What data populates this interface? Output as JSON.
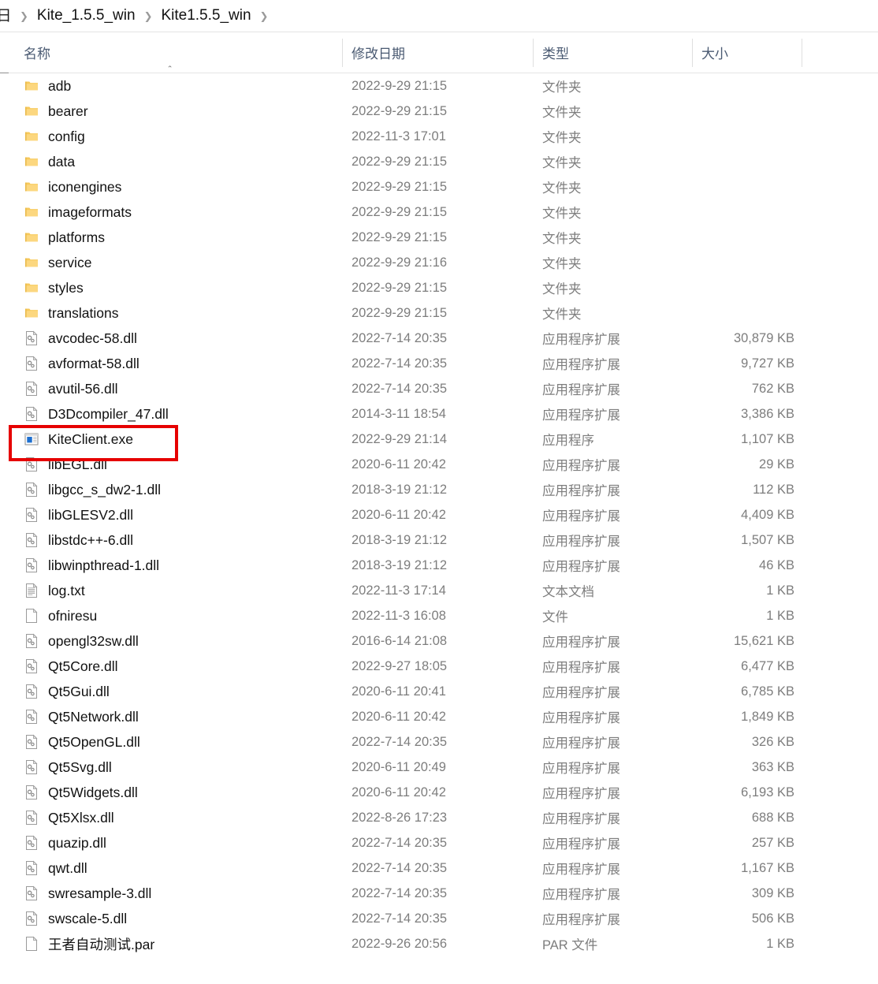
{
  "breadcrumb": {
    "root_icon": "drive-icon",
    "root_glyph": "日",
    "separator": "❯",
    "items": [
      "Kite_1.5.5_win",
      "Kite1.5.5_win"
    ],
    "trailing_separator": "❯"
  },
  "columns": {
    "name": "名称",
    "date_modified": "修改日期",
    "type": "类型",
    "size": "大小",
    "sort_caret": "＾",
    "sort_direction": "ascending"
  },
  "annotation": {
    "color": "#e60000",
    "target": "KiteClient.exe"
  },
  "rows": [
    {
      "icon": "folder-icon",
      "name": "adb",
      "date": "2022-9-29 21:15",
      "type": "文件夹",
      "size": ""
    },
    {
      "icon": "folder-icon",
      "name": "bearer",
      "date": "2022-9-29 21:15",
      "type": "文件夹",
      "size": ""
    },
    {
      "icon": "folder-icon",
      "name": "config",
      "date": "2022-11-3 17:01",
      "type": "文件夹",
      "size": ""
    },
    {
      "icon": "folder-icon",
      "name": "data",
      "date": "2022-9-29 21:15",
      "type": "文件夹",
      "size": ""
    },
    {
      "icon": "folder-icon",
      "name": "iconengines",
      "date": "2022-9-29 21:15",
      "type": "文件夹",
      "size": ""
    },
    {
      "icon": "folder-icon",
      "name": "imageformats",
      "date": "2022-9-29 21:15",
      "type": "文件夹",
      "size": ""
    },
    {
      "icon": "folder-icon",
      "name": "platforms",
      "date": "2022-9-29 21:15",
      "type": "文件夹",
      "size": ""
    },
    {
      "icon": "folder-icon",
      "name": "service",
      "date": "2022-9-29 21:16",
      "type": "文件夹",
      "size": ""
    },
    {
      "icon": "folder-icon",
      "name": "styles",
      "date": "2022-9-29 21:15",
      "type": "文件夹",
      "size": ""
    },
    {
      "icon": "folder-icon",
      "name": "translations",
      "date": "2022-9-29 21:15",
      "type": "文件夹",
      "size": ""
    },
    {
      "icon": "dll-icon",
      "name": "avcodec-58.dll",
      "date": "2022-7-14 20:35",
      "type": "应用程序扩展",
      "size": "30,879 KB"
    },
    {
      "icon": "dll-icon",
      "name": "avformat-58.dll",
      "date": "2022-7-14 20:35",
      "type": "应用程序扩展",
      "size": "9,727 KB"
    },
    {
      "icon": "dll-icon",
      "name": "avutil-56.dll",
      "date": "2022-7-14 20:35",
      "type": "应用程序扩展",
      "size": "762 KB"
    },
    {
      "icon": "dll-icon",
      "name": "D3Dcompiler_47.dll",
      "date": "2014-3-11 18:54",
      "type": "应用程序扩展",
      "size": "3,386 KB"
    },
    {
      "icon": "exe-icon",
      "name": "KiteClient.exe",
      "date": "2022-9-29 21:14",
      "type": "应用程序",
      "size": "1,107 KB"
    },
    {
      "icon": "dll-icon",
      "name": "libEGL.dll",
      "date": "2020-6-11 20:42",
      "type": "应用程序扩展",
      "size": "29 KB"
    },
    {
      "icon": "dll-icon",
      "name": "libgcc_s_dw2-1.dll",
      "date": "2018-3-19 21:12",
      "type": "应用程序扩展",
      "size": "112 KB"
    },
    {
      "icon": "dll-icon",
      "name": "libGLESV2.dll",
      "date": "2020-6-11 20:42",
      "type": "应用程序扩展",
      "size": "4,409 KB"
    },
    {
      "icon": "dll-icon",
      "name": "libstdc++-6.dll",
      "date": "2018-3-19 21:12",
      "type": "应用程序扩展",
      "size": "1,507 KB"
    },
    {
      "icon": "dll-icon",
      "name": "libwinpthread-1.dll",
      "date": "2018-3-19 21:12",
      "type": "应用程序扩展",
      "size": "46 KB"
    },
    {
      "icon": "text-icon",
      "name": "log.txt",
      "date": "2022-11-3 17:14",
      "type": "文本文档",
      "size": "1 KB"
    },
    {
      "icon": "blank-file-icon",
      "name": "ofniresu",
      "date": "2022-11-3 16:08",
      "type": "文件",
      "size": "1 KB"
    },
    {
      "icon": "dll-icon",
      "name": "opengl32sw.dll",
      "date": "2016-6-14 21:08",
      "type": "应用程序扩展",
      "size": "15,621 KB"
    },
    {
      "icon": "dll-icon",
      "name": "Qt5Core.dll",
      "date": "2022-9-27 18:05",
      "type": "应用程序扩展",
      "size": "6,477 KB"
    },
    {
      "icon": "dll-icon",
      "name": "Qt5Gui.dll",
      "date": "2020-6-11 20:41",
      "type": "应用程序扩展",
      "size": "6,785 KB"
    },
    {
      "icon": "dll-icon",
      "name": "Qt5Network.dll",
      "date": "2020-6-11 20:42",
      "type": "应用程序扩展",
      "size": "1,849 KB"
    },
    {
      "icon": "dll-icon",
      "name": "Qt5OpenGL.dll",
      "date": "2022-7-14 20:35",
      "type": "应用程序扩展",
      "size": "326 KB"
    },
    {
      "icon": "dll-icon",
      "name": "Qt5Svg.dll",
      "date": "2020-6-11 20:49",
      "type": "应用程序扩展",
      "size": "363 KB"
    },
    {
      "icon": "dll-icon",
      "name": "Qt5Widgets.dll",
      "date": "2020-6-11 20:42",
      "type": "应用程序扩展",
      "size": "6,193 KB"
    },
    {
      "icon": "dll-icon",
      "name": "Qt5Xlsx.dll",
      "date": "2022-8-26 17:23",
      "type": "应用程序扩展",
      "size": "688 KB"
    },
    {
      "icon": "dll-icon",
      "name": "quazip.dll",
      "date": "2022-7-14 20:35",
      "type": "应用程序扩展",
      "size": "257 KB"
    },
    {
      "icon": "dll-icon",
      "name": "qwt.dll",
      "date": "2022-7-14 20:35",
      "type": "应用程序扩展",
      "size": "1,167 KB"
    },
    {
      "icon": "dll-icon",
      "name": "swresample-3.dll",
      "date": "2022-7-14 20:35",
      "type": "应用程序扩展",
      "size": "309 KB"
    },
    {
      "icon": "dll-icon",
      "name": "swscale-5.dll",
      "date": "2022-7-14 20:35",
      "type": "应用程序扩展",
      "size": "506 KB"
    },
    {
      "icon": "blank-file-icon",
      "name": "王者自动测试.par",
      "date": "2022-9-26 20:56",
      "type": "PAR 文件",
      "size": "1 KB"
    }
  ]
}
